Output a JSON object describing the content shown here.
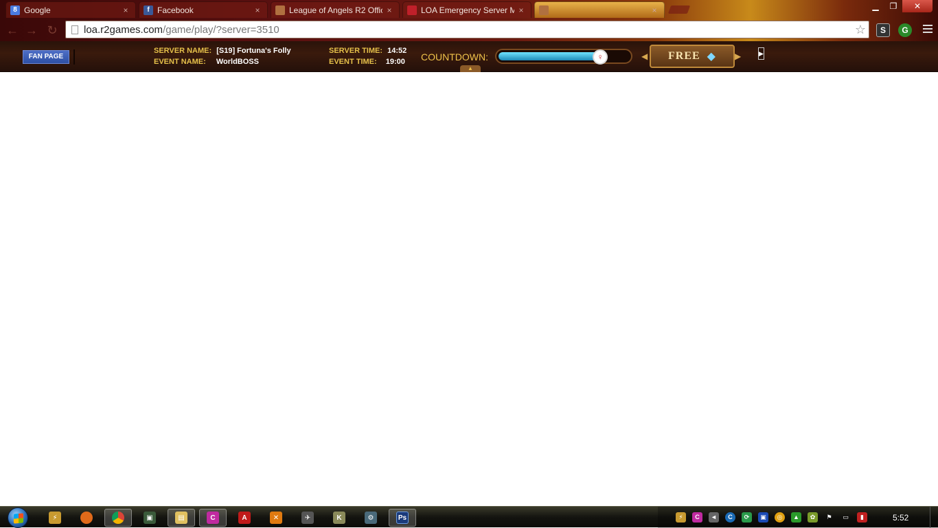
{
  "tabs": [
    {
      "title": "Google",
      "favicon": "google-icon",
      "color": "#4a7be0"
    },
    {
      "title": "Facebook",
      "favicon": "facebook-icon",
      "color": "#3b5998"
    },
    {
      "title": "League of Angels R2 Offic",
      "favicon": "league-of-angels-icon",
      "color": "#b07040"
    },
    {
      "title": "LOA Emergency Server M",
      "favicon": "loa-emergency-icon",
      "color": "#c0202a"
    },
    {
      "title": "",
      "favicon": "loa-game-icon",
      "color": "#b07040"
    }
  ],
  "address_bar": {
    "host": "loa.r2games.com",
    "path": "/game/play/?server=3510"
  },
  "game_header": {
    "fan_page_label": "FAN PAGE",
    "server_name_key": "SERVER NAME:",
    "server_name_value": "[S19] Fortuna's Folly",
    "event_name_key": "EVENT NAME:",
    "event_name_value": "WorldBOSS",
    "server_time_key": "SERVER TIME:",
    "server_time_value": "14:52",
    "event_time_key": "EVENT TIME:",
    "event_time_value": "19:00",
    "countdown_label": "COUNTDOWN:",
    "countdown_progress": 0.78,
    "free_label": "FREE"
  },
  "taskbar": {
    "clock": "5:52",
    "pinned": [
      "app-icon",
      "firefox-icon",
      "chrome-icon",
      "monitor-icon",
      "explorer-icon",
      "app-c-icon",
      "acrobat-icon",
      "app-x-icon",
      "app-plane-icon",
      "counter-strike-icon",
      "gear-icon",
      "photoshop-icon"
    ]
  },
  "colors": {
    "accent_gold": "#e5c04a",
    "fan_page_blue": "#3b5aa8",
    "countdown_fill": "#3ab4e0"
  }
}
